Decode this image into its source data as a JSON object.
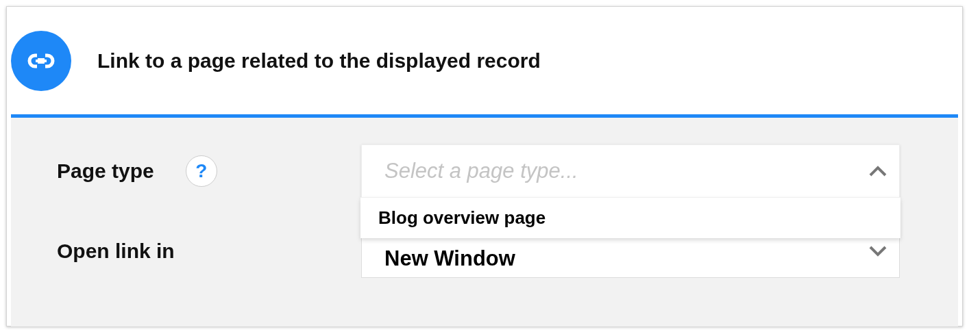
{
  "header": {
    "title": "Link to a page related to the displayed record"
  },
  "fields": [
    {
      "label": "Page type",
      "help": "?",
      "kind": "select",
      "placeholder": "Select a page type...",
      "expanded": true,
      "options": [
        {
          "label": "Blog overview page"
        }
      ]
    },
    {
      "label": "Open link in",
      "kind": "select",
      "value": "New Window",
      "expanded": false
    }
  ]
}
